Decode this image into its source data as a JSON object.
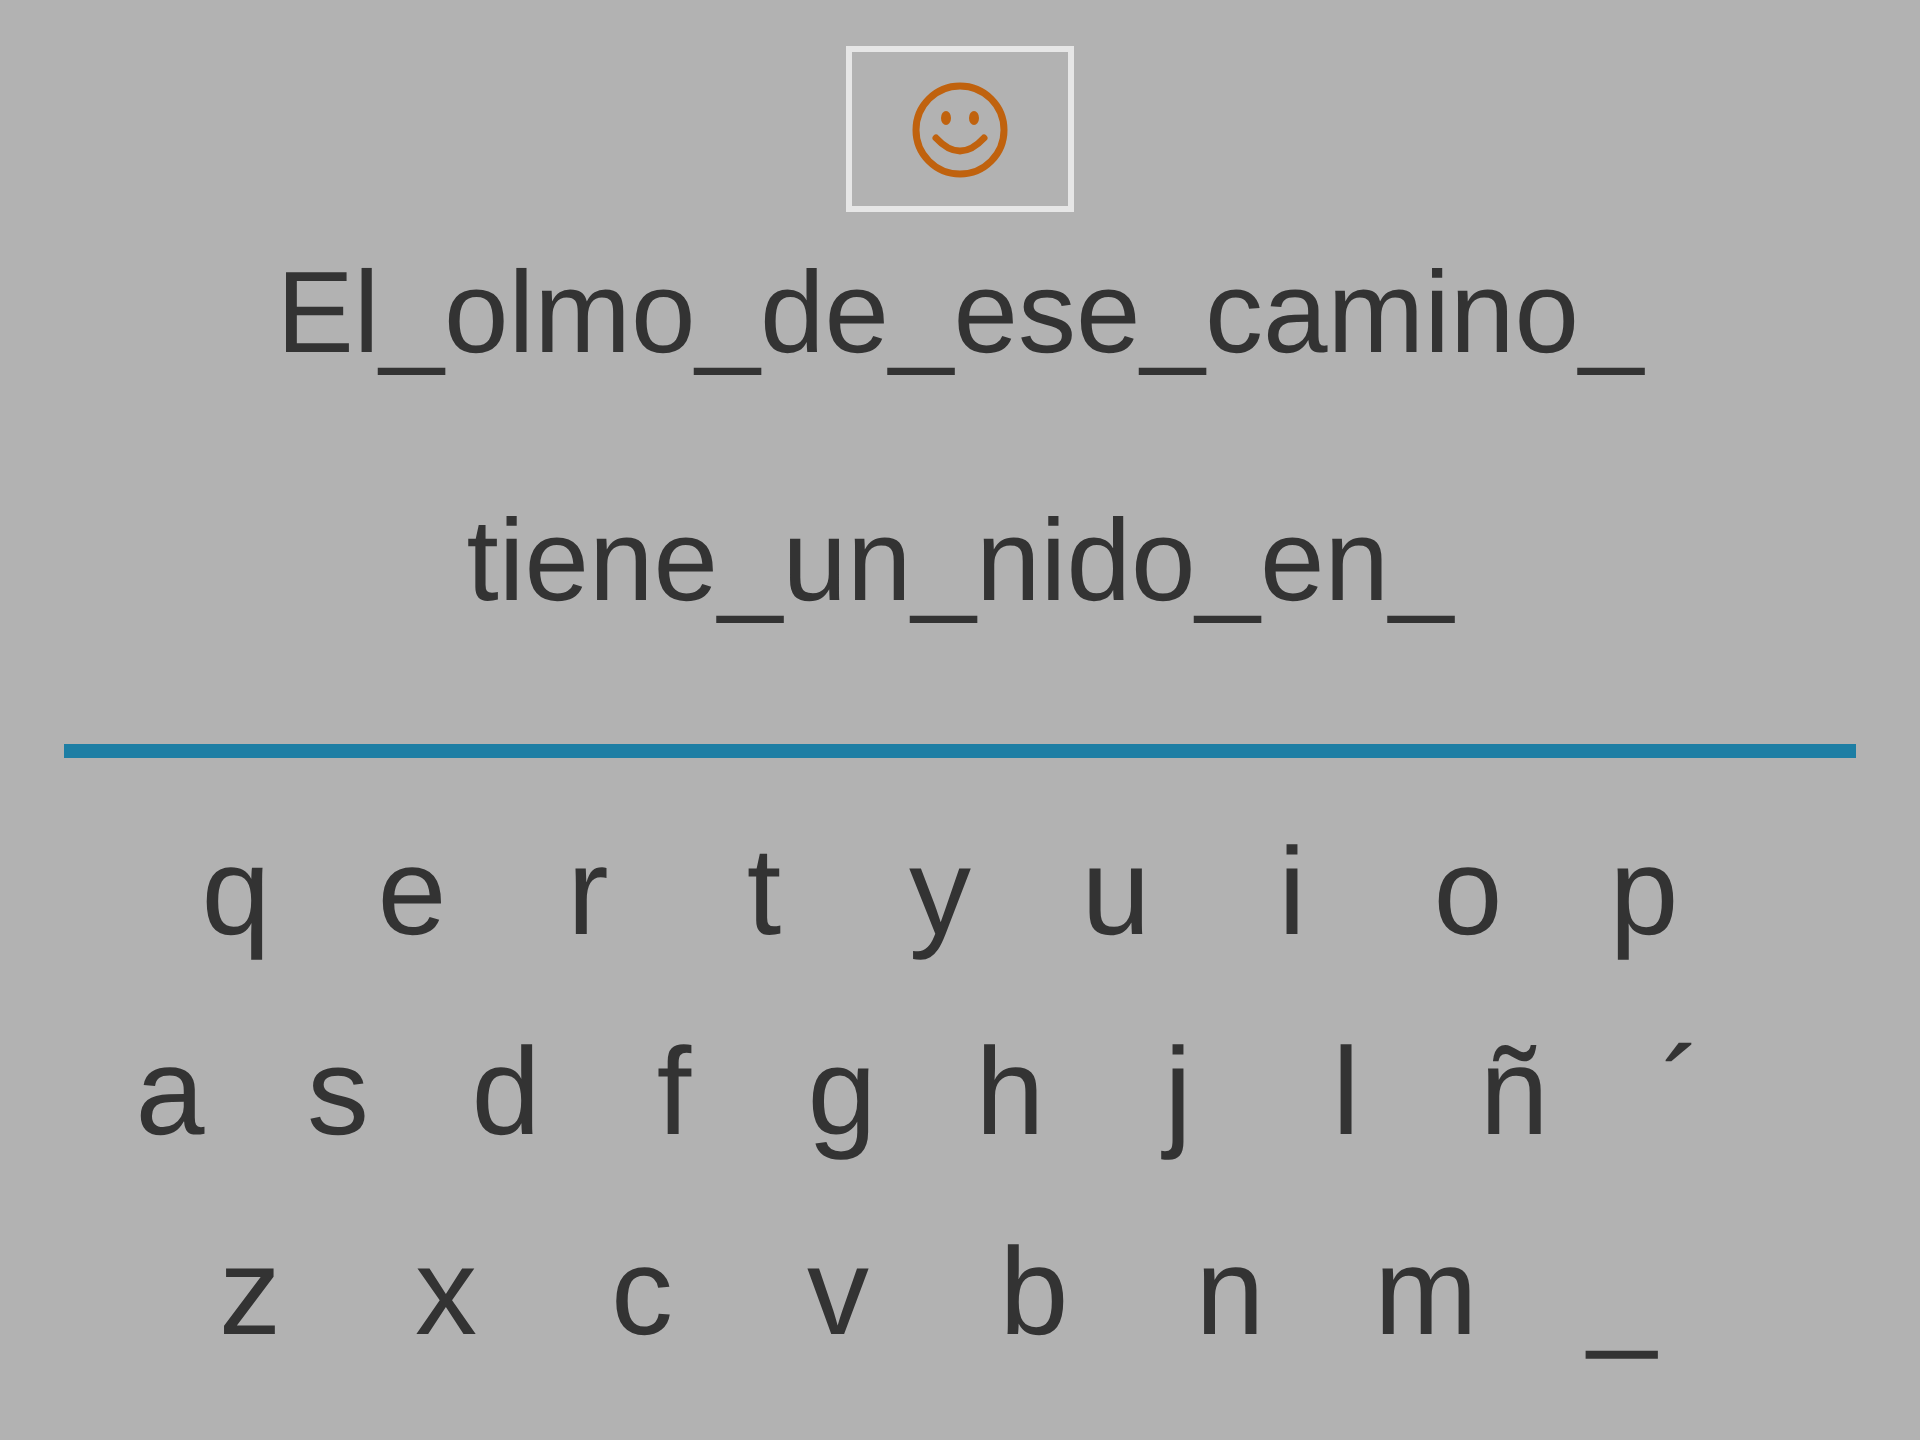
{
  "phrase_lines": [
    "El_olmo_de_ese_camino_",
    "tiene_un_nido_en_"
  ],
  "keyboard_rows": [
    [
      "q",
      "e",
      "r",
      "t",
      "y",
      "u",
      "i",
      "o",
      "p"
    ],
    [
      "a",
      "s",
      "d",
      "f",
      "g",
      "h",
      "j",
      "l",
      "ñ",
      "´"
    ],
    [
      "z",
      "x",
      "c",
      "v",
      "b",
      "n",
      "m",
      "_"
    ]
  ]
}
